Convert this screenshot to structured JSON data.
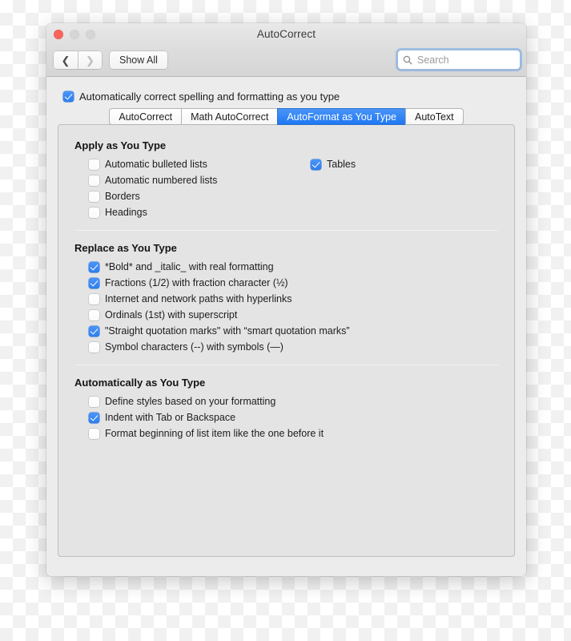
{
  "window": {
    "title": "AutoCorrect",
    "traffic_lights": [
      "close",
      "minimize",
      "zoom"
    ]
  },
  "toolbar": {
    "back_icon": "chevron-left-icon",
    "forward_icon": "chevron-right-icon",
    "show_all_label": "Show All",
    "search": {
      "icon": "search-icon",
      "placeholder": "Search",
      "value": ""
    }
  },
  "master_checkbox": {
    "label": "Automatically correct spelling and formatting as you type",
    "checked": true
  },
  "tabs": [
    {
      "label": "AutoCorrect",
      "active": false
    },
    {
      "label": "Math AutoCorrect",
      "active": false
    },
    {
      "label": "AutoFormat as You Type",
      "active": true
    },
    {
      "label": "AutoText",
      "active": false
    }
  ],
  "sections": [
    {
      "title": "Apply as You Type",
      "left_options": [
        {
          "label": "Automatic bulleted lists",
          "checked": false
        },
        {
          "label": "Automatic numbered lists",
          "checked": false
        },
        {
          "label": "Borders",
          "checked": false
        },
        {
          "label": "Headings",
          "checked": false
        }
      ],
      "right_options": [
        {
          "label": "Tables",
          "checked": true
        }
      ]
    },
    {
      "title": "Replace as You Type",
      "left_options": [
        {
          "label": "*Bold* and _italic_ with real formatting",
          "checked": true
        },
        {
          "label": "Fractions (1/2) with fraction character (½)",
          "checked": true
        },
        {
          "label": "Internet and network paths with hyperlinks",
          "checked": false
        },
        {
          "label": "Ordinals (1st) with superscript",
          "checked": false
        },
        {
          "label": "\"Straight quotation marks\" with “smart quotation marks”",
          "checked": true
        },
        {
          "label": "Symbol characters (--) with symbols (—)",
          "checked": false
        }
      ],
      "right_options": []
    },
    {
      "title": "Automatically as You Type",
      "left_options": [
        {
          "label": "Define styles based on your formatting",
          "checked": false
        },
        {
          "label": "Indent with Tab or Backspace",
          "checked": true
        },
        {
          "label": "Format beginning of list item like the one before it",
          "checked": false
        }
      ],
      "right_options": []
    }
  ],
  "colors": {
    "accent": "#2d7ef0",
    "tab_active": "#1f78f2",
    "close_button": "#f9655c",
    "window_chrome": "#ececec",
    "panel": "#e4e4e4"
  }
}
